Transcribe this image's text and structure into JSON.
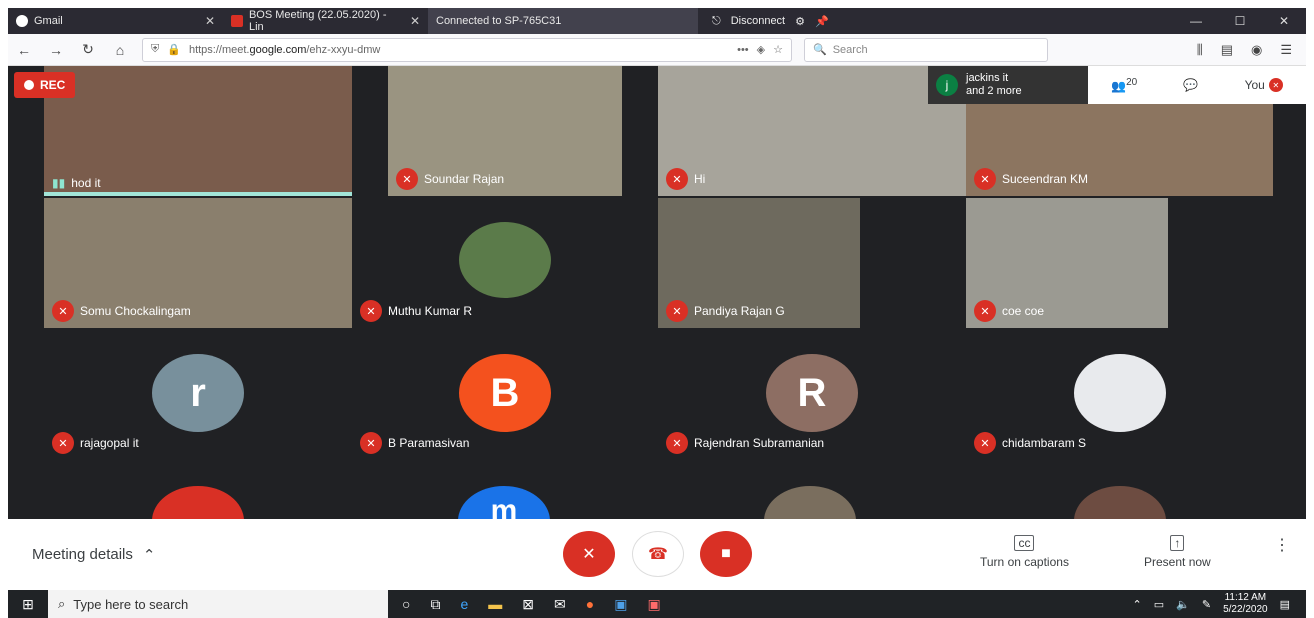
{
  "browser": {
    "tabs": [
      {
        "label": "Gmail",
        "close": "✕"
      },
      {
        "label": "BOS Meeting (22.05.2020) - Lin",
        "close": "✕"
      },
      {
        "label": "Connected to SP-765C31"
      }
    ],
    "tab_mid": {
      "disconnect_label": "Disconnect"
    },
    "window_controls": [
      "—",
      "☐",
      "✕"
    ],
    "url_prefix": "https://meet.",
    "url_domain": "google.com",
    "url_path": "/ehz-xxyu-dmw",
    "url_dots": "•••",
    "search_placeholder": "Search",
    "nav": {
      "back": "←",
      "forward": "→",
      "reload": "↻",
      "home": "⌂"
    }
  },
  "meet": {
    "rec_label": "REC",
    "top_panel": {
      "jackins_initial": "j",
      "jackins_name": "jackins it",
      "jackins_more": "and 2 more",
      "participant_count": "20",
      "you_label": "You"
    },
    "tiles": [
      {
        "name": "hod it"
      },
      {
        "name": "Soundar Rajan"
      },
      {
        "name": "Hi"
      },
      {
        "name": "Suceendran KM"
      },
      {
        "name": "Somu Chockalingam"
      },
      {
        "name": "Muthu Kumar R"
      },
      {
        "name": "Pandiya Rajan G"
      },
      {
        "name": "coe coe"
      },
      {
        "name": "rajagopal it",
        "initial": "r"
      },
      {
        "name": "B Paramasivan",
        "initial": "B"
      },
      {
        "name": "Rajendran Subramanian",
        "initial": "R"
      },
      {
        "name": "chidambaram S"
      }
    ],
    "partial_initial": "m"
  },
  "controls": {
    "meeting_details": "Meeting details",
    "captions": "Turn on captions",
    "present": "Present now",
    "more": "⋮"
  },
  "taskbar": {
    "search_placeholder": "Type here to search",
    "time": "11:12 AM",
    "date": "5/22/2020"
  },
  "colors": {
    "red": "#d93025",
    "meet_bg": "#202124",
    "avatar_r": "#78909c",
    "avatar_B": "#f4511e",
    "avatar_R": "#8d6e63"
  }
}
